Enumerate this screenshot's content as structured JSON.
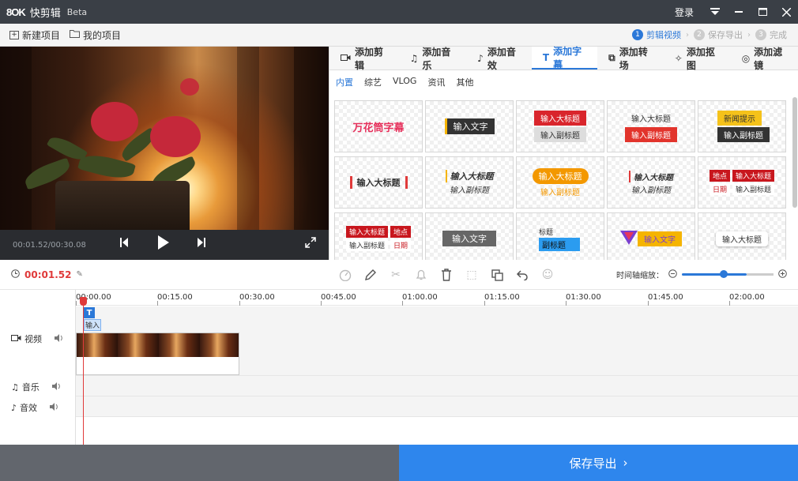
{
  "app": {
    "logo": "8OK",
    "name": "快剪辑",
    "beta": "Beta"
  },
  "titlebar": {
    "login": "登录"
  },
  "toolbar": {
    "new_project": "新建项目",
    "my_projects": "我的项目",
    "steps": [
      {
        "num": "1",
        "label": "剪辑视频"
      },
      {
        "num": "2",
        "label": "保存导出"
      },
      {
        "num": "3",
        "label": "完成"
      }
    ]
  },
  "preview": {
    "time": "00:01.52/00:30.08"
  },
  "panel": {
    "tabs": [
      "添加剪辑",
      "添加音乐",
      "添加音效",
      "添加字幕",
      "添加转场",
      "添加抠图",
      "添加滤镜"
    ],
    "subtabs": [
      "内置",
      "综艺",
      "VLOG",
      "资讯",
      "其他"
    ],
    "cards": {
      "c1": "万花筒字幕",
      "c2": "输入文字",
      "c3a": "输入大标题",
      "c3b": "输入副标题",
      "c4a": "输入大标题",
      "c4b": "输入副标题",
      "c5a": "新闻提示",
      "c5b": "输入副标题",
      "c6": "输入大标题",
      "c7a": "输入大标题",
      "c7b": "输入副标题",
      "c8a": "输入大标题",
      "c8b": "输入副标题",
      "c9a": "输入大标题",
      "c9b": "输入副标题",
      "c10a": "地点",
      "c10b": "输入大标题",
      "c10c": "日期",
      "c10d": "输入副标题",
      "c11a": "输入大标题",
      "c11b": "地点",
      "c11c": "输入副标题",
      "c11d": "日期",
      "c12": "输入文字",
      "c13a": "标题",
      "c13b": "副标题",
      "c14": "输入文字",
      "c15": "输入大标题"
    }
  },
  "timeline": {
    "timecode": "00:01.52",
    "zoom_label": "时间轴缩放：",
    "ticks": [
      "00:00.00",
      "00:15.00",
      "00:30.00",
      "00:45.00",
      "01:00.00",
      "01:15.00",
      "01:30.00",
      "01:45.00",
      "02:00.00"
    ],
    "tracks": {
      "video": "视频",
      "music": "音乐",
      "sfx": "音效"
    },
    "subtitle_clip": "输入"
  },
  "bottom": {
    "export": "保存导出"
  },
  "colors": {
    "accent": "#2b78d8",
    "playhead": "#e03a3a",
    "export_bg": "#2e86ed",
    "titlebar": "#3a3f46"
  }
}
